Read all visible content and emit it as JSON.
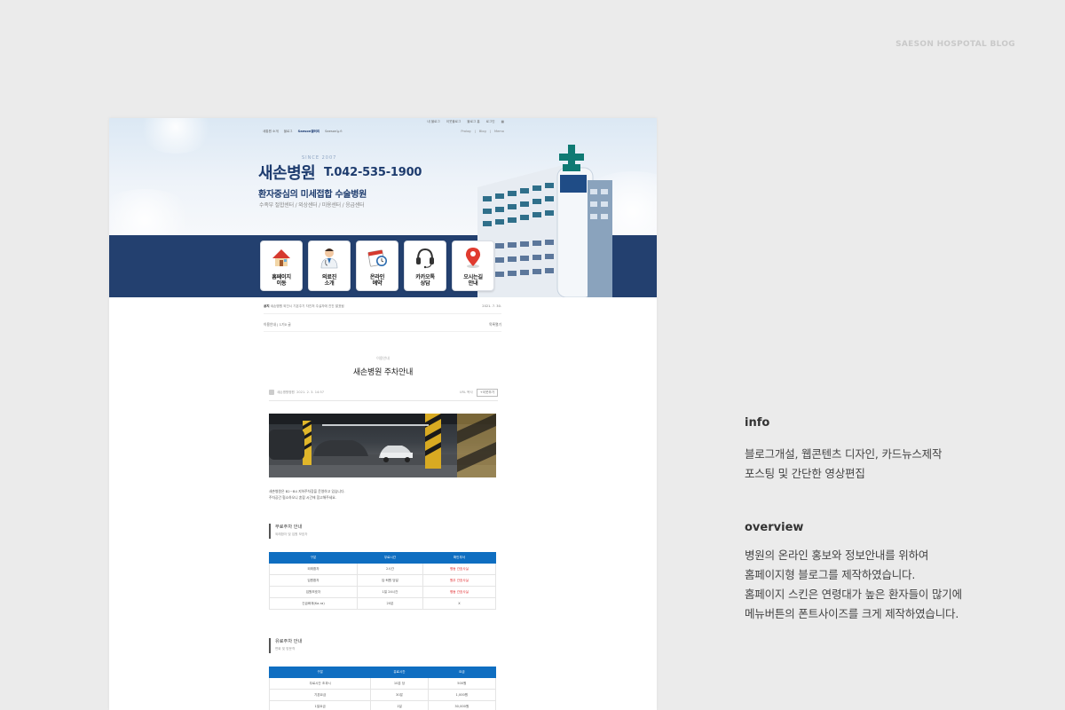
{
  "blog_tag": "SAESON HOSPOTAL BLOG",
  "site": {
    "top_nav": [
      "내 블로그",
      "이웃블로그",
      "블로그 홈",
      "로그인"
    ],
    "left_nav": [
      "새통원 소개",
      "블로그",
      "Saeson갤러리",
      "Saeson뉴스"
    ],
    "right_nav": [
      "Prolog",
      "Blog",
      "Memo"
    ],
    "since": "SINCE 2007",
    "hospital_name": "새손병원",
    "phone": "T.042-535-1900",
    "slogan": "환자중심의 미세접합 수술병원",
    "centers": "수족부 절합센터 / 외상센터 / 미용센터 / 응급센터",
    "menus": [
      {
        "label": "홈페이지\n이동",
        "icon": "home-icon"
      },
      {
        "label": "의료진\n소개",
        "icon": "doctor-icon"
      },
      {
        "label": "온라인\n예약",
        "icon": "calendar-icon"
      },
      {
        "label": "카카오톡\n상담",
        "icon": "headset-icon"
      },
      {
        "label": "오시는길\n안내",
        "icon": "location-pin-icon"
      }
    ],
    "notice_label": "공지",
    "notice_text": "새손병원 외진시 기온주기 자진처 주실자에 진진 발표됨",
    "notice_date": "2021. 7. 30.",
    "category_line": "이용안내 | 1기0 글",
    "list_link": "목록열기"
  },
  "post": {
    "category": "이용안내",
    "title": "새손병원 주차안내",
    "author": "새손병원병원",
    "date": "2021. 2. 3. 14:57",
    "url_label": "URL 복사",
    "neighbor_button": "+이웃추가",
    "intro_lines": [
      "새손병원은 B2~B4 지하주차장을 운영하고 있습니다.",
      "주차공간 협소하오니 혼잡 시간에 참고해주세요."
    ]
  },
  "table1": {
    "title": "무료주차 안내",
    "sub": "외래환자 및 입원 보호자",
    "headers": [
      "구분",
      "무료시간",
      "확인부서"
    ],
    "rows": [
      [
        "외래환자",
        "2시간",
        "병동 간호사실"
      ],
      [
        "입원환자",
        "입·퇴원 당일",
        "원무 간호사실"
      ],
      [
        "입원보호자",
        "1일 24시간",
        "병동 간호사실"
      ],
      [
        "긴급화재(Ka-ra)",
        "20분",
        "X"
      ]
    ]
  },
  "table2": {
    "title": "유료주차 안내",
    "sub": "면회 및 방문객",
    "headers": [
      "구분",
      "유료시간",
      "요금"
    ],
    "rows": [
      [
        "무료시간 초과시",
        "10분 당",
        "500원"
      ],
      [
        "기본요금",
        "30분",
        "1,000원"
      ],
      [
        "1일요금",
        "1일",
        "30,000원"
      ]
    ]
  },
  "side": {
    "info_heading": "info",
    "info_text": "블로그개설, 웹콘텐츠 디자인, 카드뉴스제작\n포스팅 및 간단한 영상편집",
    "overview_heading": "overview",
    "overview_text": "병원의 온라인 홍보와 정보안내를  위하여\n홈페이지형 블로그를 제작하였습니다.\n홈페이지 스킨은 연령대가 높은 환자들이 많기에\n메뉴버튼의 폰트사이즈를 크게 제작하였습니다."
  },
  "colors": {
    "navy": "#23406f",
    "table_header": "#0f6ec1",
    "red_text": "#e0282b"
  }
}
